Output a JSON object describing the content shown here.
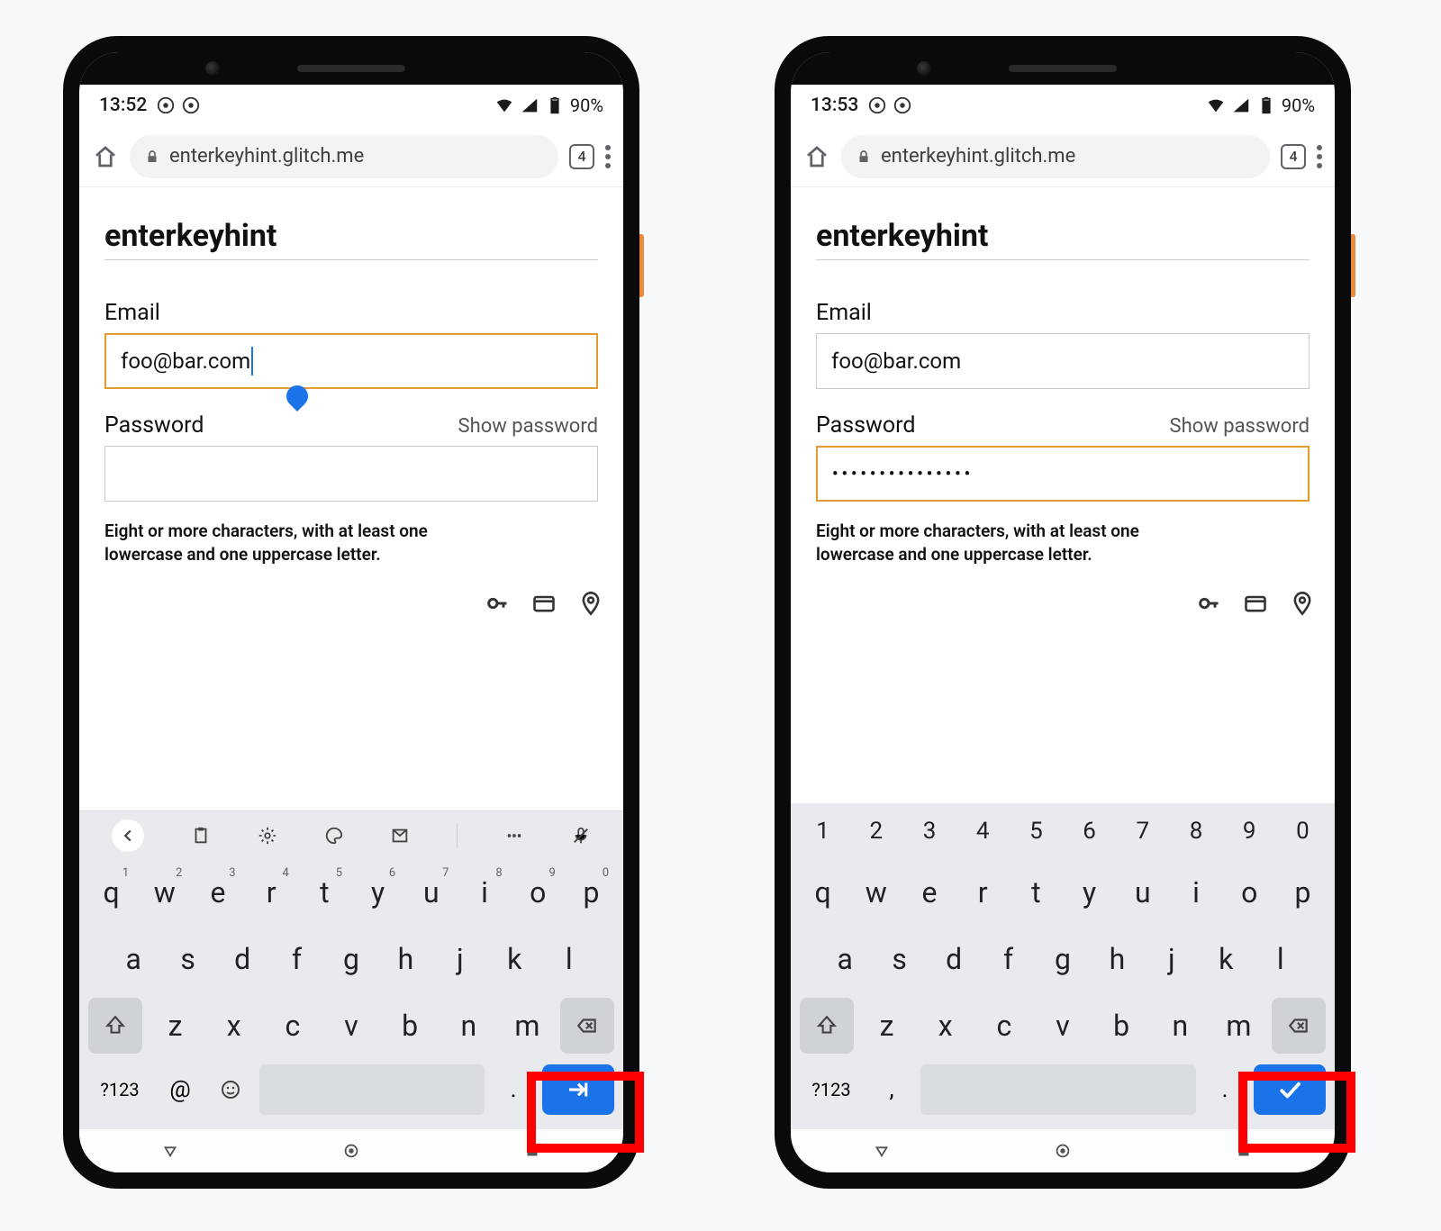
{
  "phones": [
    {
      "status": {
        "time": "13:52",
        "battery": "90%"
      },
      "toolbar": {
        "url": "enterkeyhint.glitch.me",
        "tab_count": "4"
      },
      "page": {
        "title": "enterkeyhint",
        "email_label": "Email",
        "email_value": "foo@bar.com",
        "password_label": "Password",
        "show_password": "Show password",
        "password_value": "",
        "hint": "Eight or more characters, with at least one lowercase and one uppercase letter.",
        "focused": "email"
      },
      "keyboard": {
        "mode": "email",
        "row1": [
          {
            "k": "q",
            "n": "1"
          },
          {
            "k": "w",
            "n": "2"
          },
          {
            "k": "e",
            "n": "3"
          },
          {
            "k": "r",
            "n": "4"
          },
          {
            "k": "t",
            "n": "5"
          },
          {
            "k": "y",
            "n": "6"
          },
          {
            "k": "u",
            "n": "7"
          },
          {
            "k": "i",
            "n": "8"
          },
          {
            "k": "o",
            "n": "9"
          },
          {
            "k": "p",
            "n": "0"
          }
        ],
        "row2": [
          "a",
          "s",
          "d",
          "f",
          "g",
          "h",
          "j",
          "k",
          "l"
        ],
        "row3": [
          "z",
          "x",
          "c",
          "v",
          "b",
          "n",
          "m"
        ],
        "sym": "?123",
        "left1": "@",
        "dot": ".",
        "enter": "next"
      }
    },
    {
      "status": {
        "time": "13:53",
        "battery": "90%"
      },
      "toolbar": {
        "url": "enterkeyhint.glitch.me",
        "tab_count": "4"
      },
      "page": {
        "title": "enterkeyhint",
        "email_label": "Email",
        "email_value": "foo@bar.com",
        "password_label": "Password",
        "show_password": "Show password",
        "password_value": "•••••••••••••••",
        "hint": "Eight or more characters, with at least one lowercase and one uppercase letter.",
        "focused": "password"
      },
      "keyboard": {
        "mode": "password",
        "numrow": [
          "1",
          "2",
          "3",
          "4",
          "5",
          "6",
          "7",
          "8",
          "9",
          "0"
        ],
        "row1": [
          {
            "k": "q"
          },
          {
            "k": "w"
          },
          {
            "k": "e"
          },
          {
            "k": "r"
          },
          {
            "k": "t"
          },
          {
            "k": "y"
          },
          {
            "k": "u"
          },
          {
            "k": "i"
          },
          {
            "k": "o"
          },
          {
            "k": "p"
          }
        ],
        "row2": [
          "a",
          "s",
          "d",
          "f",
          "g",
          "h",
          "j",
          "k",
          "l"
        ],
        "row3": [
          "z",
          "x",
          "c",
          "v",
          "b",
          "n",
          "m"
        ],
        "sym": "?123",
        "left1": ",",
        "dot": ".",
        "enter": "done"
      }
    }
  ]
}
